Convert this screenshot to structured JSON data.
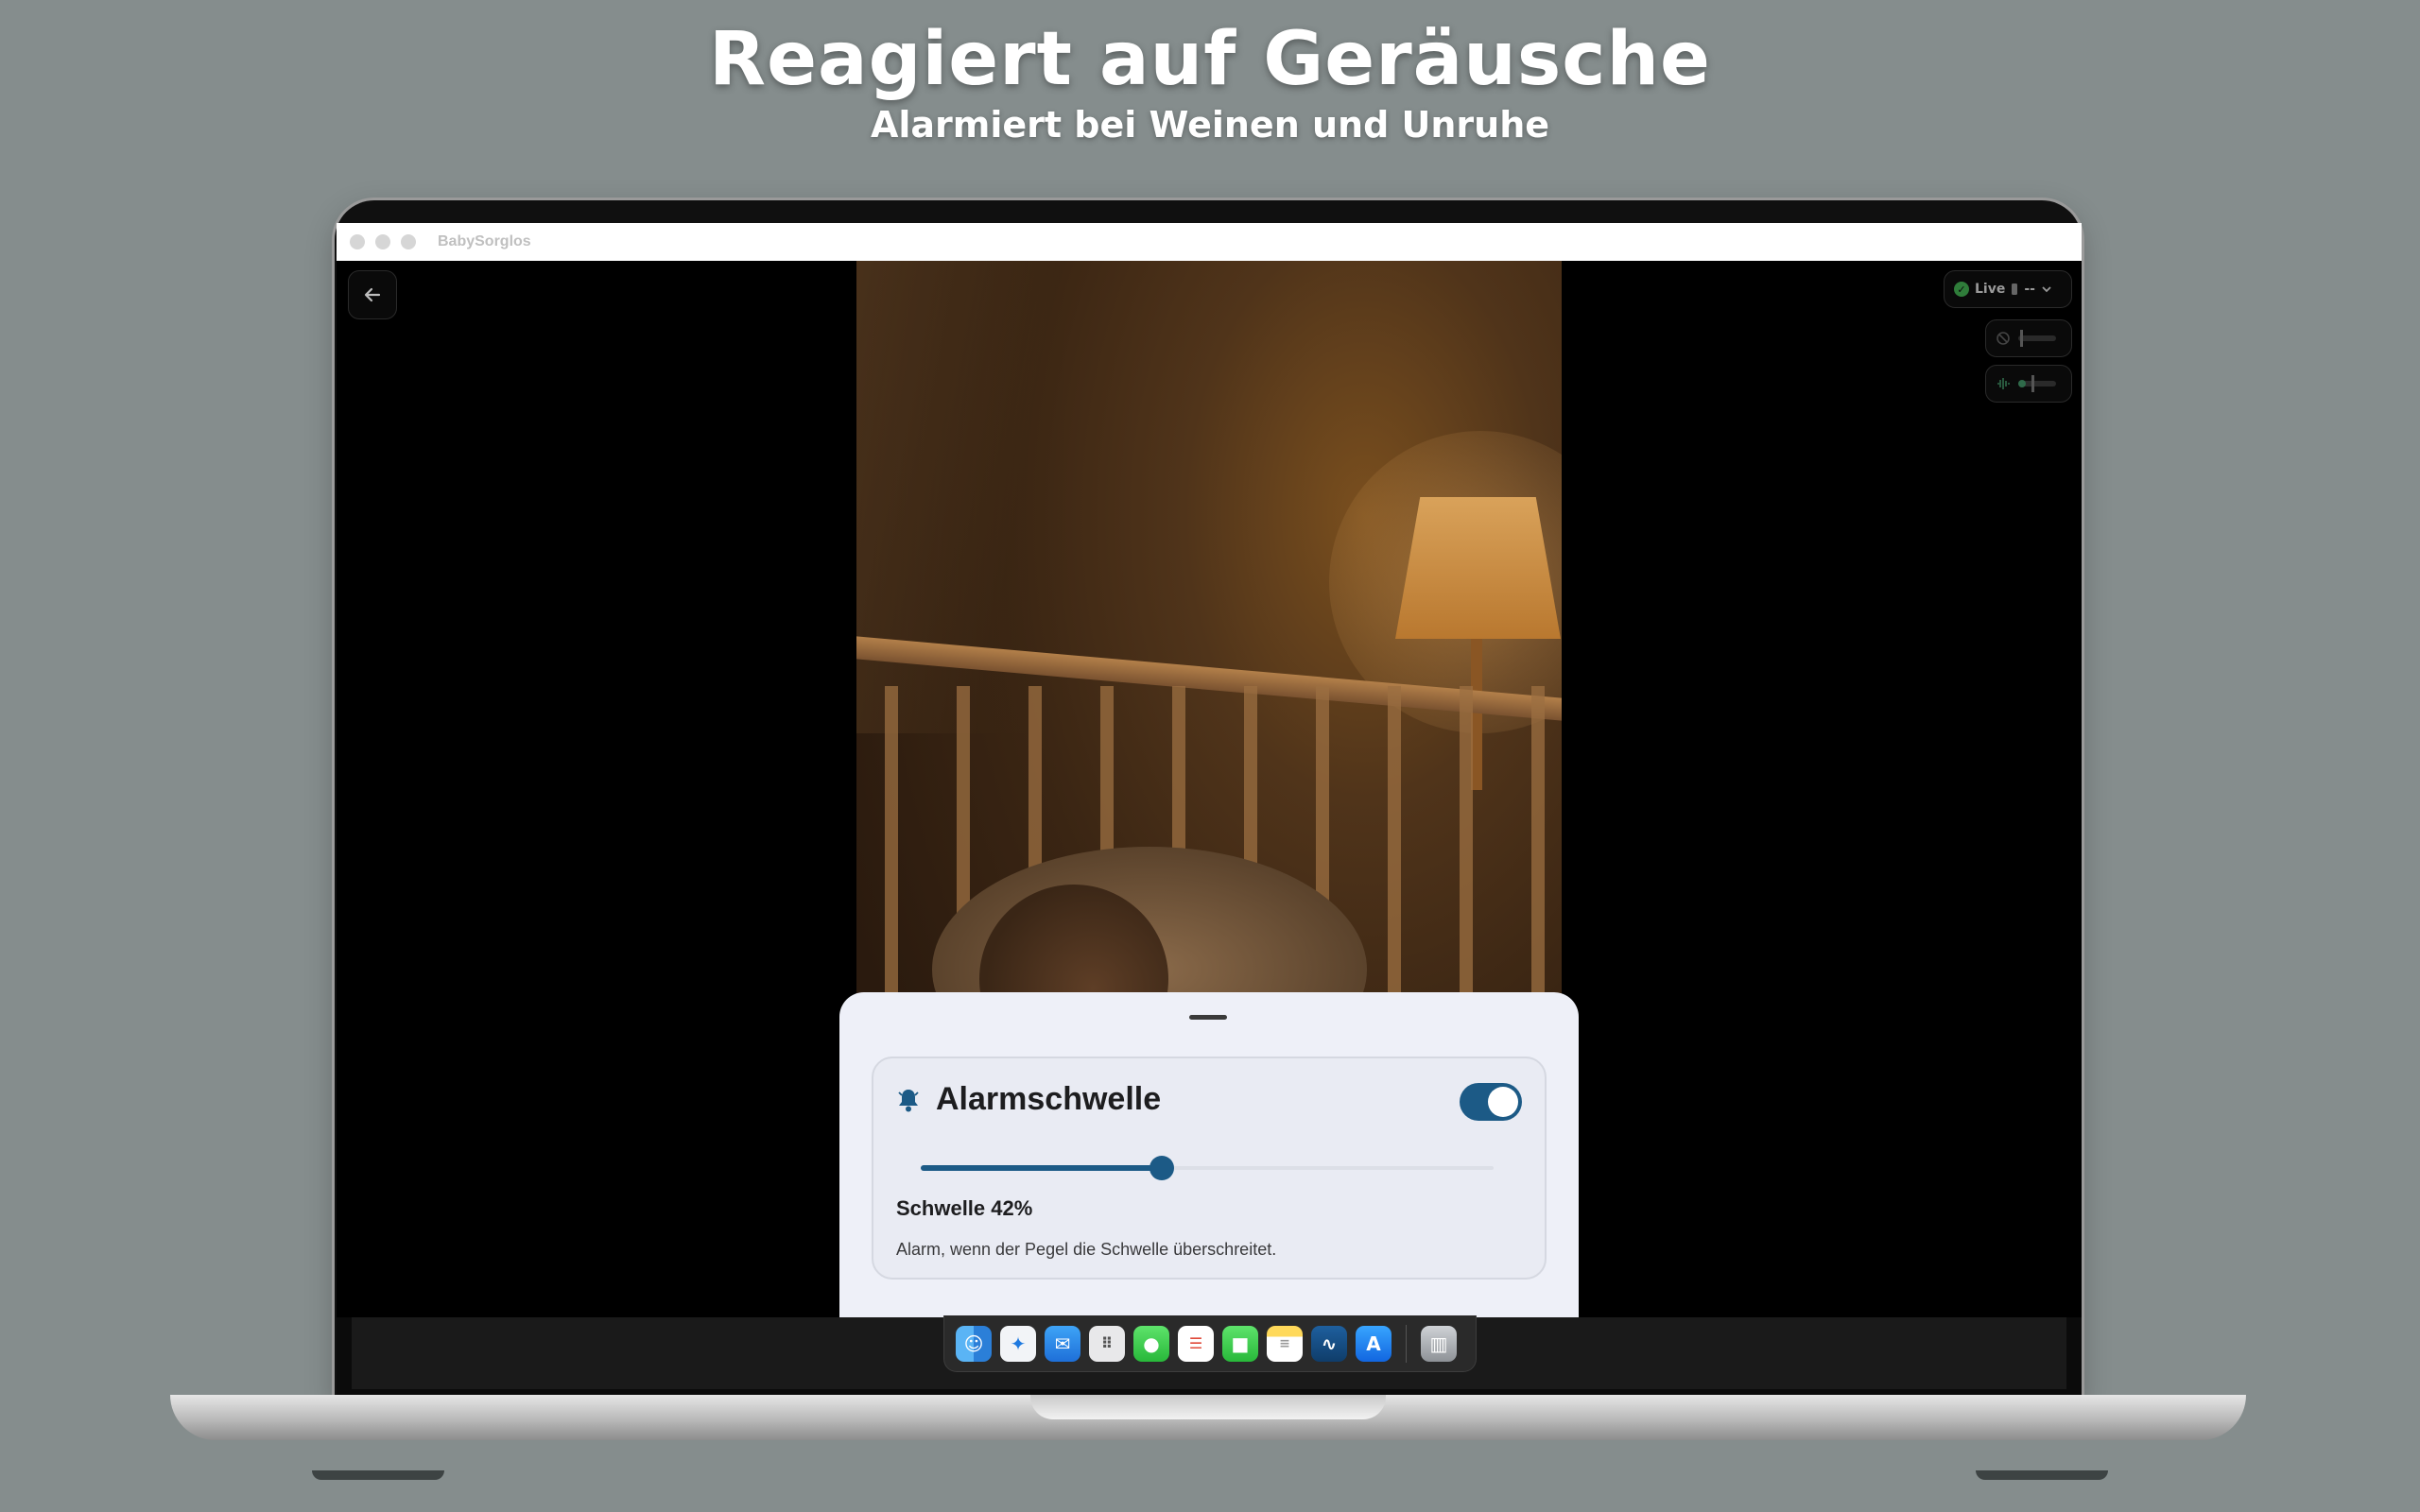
{
  "promo": {
    "headline": "Reagiert auf Geräusche",
    "subheadline": "Alarmiert bei Weinen und Unruhe"
  },
  "window": {
    "title": "BabySorglos"
  },
  "stream": {
    "status_label": "Live",
    "signal_value": "--"
  },
  "alarm_card": {
    "title": "Alarmschwelle",
    "enabled": true,
    "threshold_percent": 42,
    "threshold_label": "Schwelle 42%",
    "description": "Alarm, wenn der Pegel die Schwelle überschreitet."
  },
  "colors": {
    "accent": "#1c5a86",
    "background": "#858d8d",
    "sheet": "#eef0f8",
    "live_green": "#2f7d3a"
  },
  "dock": {
    "icons": [
      "finder-icon",
      "safari-icon",
      "mail-icon",
      "launchpad-icon",
      "messages-icon",
      "reminders-icon",
      "facetime-icon",
      "notes-icon",
      "freeform-icon",
      "app-store-icon",
      "trash-icon"
    ]
  }
}
